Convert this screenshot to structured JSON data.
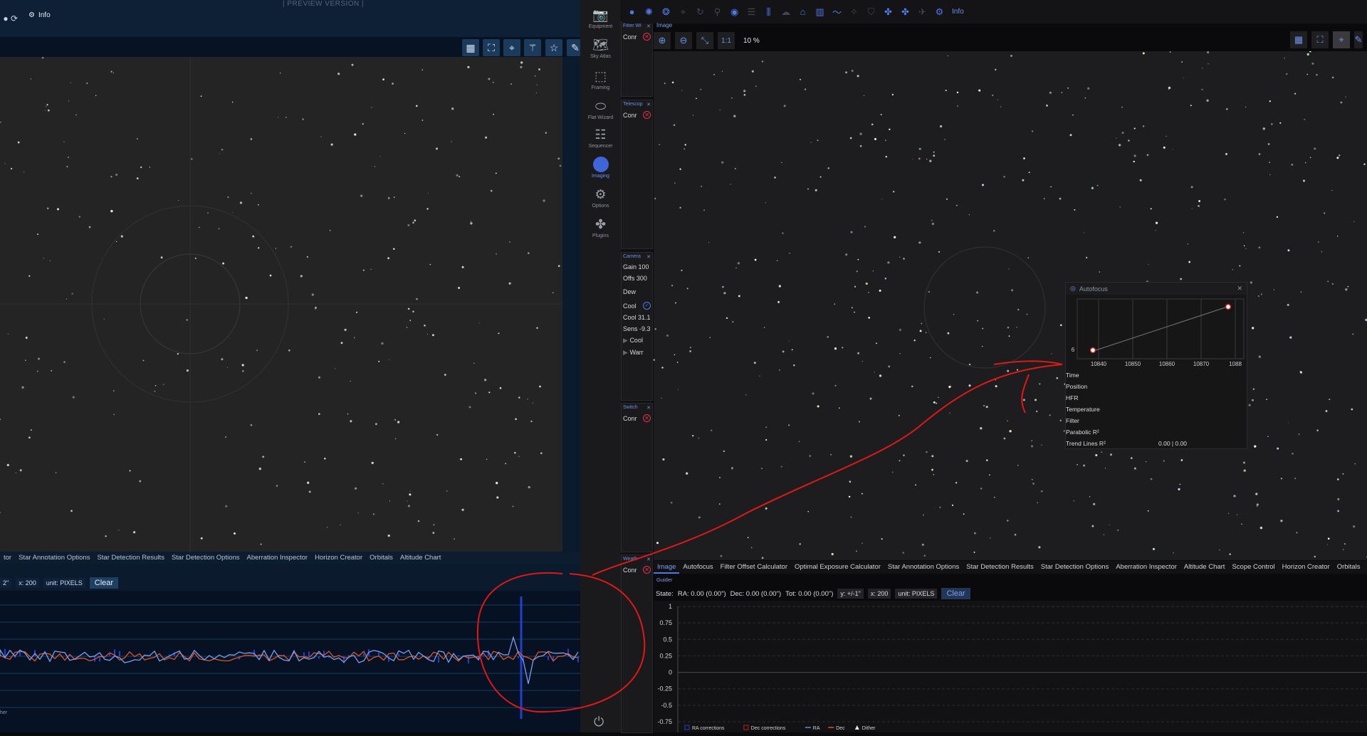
{
  "left_window": {
    "preview_label": "| PREVIEW VERSION |",
    "info_label": "Info",
    "tabs": [
      "tor",
      "Star Annotation Options",
      "Star Detection Results",
      "Star Detection Options",
      "Aberration Inspector",
      "Horizon Creator",
      "Orbitals",
      "Altitude Chart"
    ],
    "graph_controls": {
      "y_select": "2\"",
      "x_select": "x: 200",
      "unit_select": "unit: PIXELS",
      "clear": "Clear"
    },
    "legend_fragment": "her"
  },
  "nav": {
    "items": [
      {
        "label": "Equipment",
        "icon": "camera-icon"
      },
      {
        "label": "Sky Atlas",
        "icon": "map-icon"
      },
      {
        "label": "Framing",
        "icon": "framing-icon"
      },
      {
        "label": "Flat Wizard",
        "icon": "flat-wizard-icon"
      },
      {
        "label": "Sequencer",
        "icon": "sequencer-icon"
      },
      {
        "label": "Imaging",
        "icon": "imaging-icon"
      },
      {
        "label": "Options",
        "icon": "gears-icon"
      },
      {
        "label": "Plugins",
        "icon": "puzzle-icon"
      }
    ]
  },
  "equipment_panels": {
    "filter_wheel": {
      "title": "Filter Wl",
      "row": "Conr"
    },
    "telescope": {
      "title": "Telescop",
      "row": "Conr"
    },
    "camera": {
      "title": "Camera",
      "gain": "Gain",
      "gain_val": "100",
      "offset": "Offs",
      "offset_val": "300",
      "dew": "Dew",
      "cooler": "Cool",
      "cool_temp": "Cool",
      "cool_temp_val": "31.1",
      "sensor": "Sens",
      "sensor_val": "-9.3",
      "cool_toggle": "Cool",
      "warm_toggle": "Warr"
    },
    "switch": {
      "title": "Switch",
      "row": "Conr"
    },
    "weather": {
      "title": "Weath",
      "row": "Conr"
    }
  },
  "image_panel": {
    "title": "Image",
    "zoom_one": "1:1",
    "zoom_level": "10 %",
    "info_label": "Info"
  },
  "autofocus": {
    "title": "Autofocus",
    "y_tick": "6",
    "x_ticks": [
      "10840",
      "10850",
      "10860",
      "10870",
      "1088"
    ],
    "rows": [
      {
        "key": "Time",
        "value": ""
      },
      {
        "key": "Position",
        "value": ""
      },
      {
        "key": "HFR",
        "value": ""
      },
      {
        "key": "Temperature",
        "value": ""
      },
      {
        "key": "Filter",
        "value": ""
      },
      {
        "key": "Parabolic R²",
        "value": ""
      },
      {
        "key": "Trend Lines R²",
        "value": "0.00 | 0.00"
      }
    ]
  },
  "bottom_tabs": [
    "Image",
    "Autofocus",
    "Filter Offset Calculator",
    "Optimal Exposure Calculator",
    "Star Annotation Options",
    "Star Detection Results",
    "Star Detection Options",
    "Aberration Inspector",
    "Altitude Chart",
    "Scope Control",
    "Horizon Creator",
    "Orbitals"
  ],
  "guider": {
    "title": "Guider",
    "state": "State:",
    "ra": "RA: 0.00 (0.00\")",
    "dec": "Dec: 0.00 (0.00\")",
    "tot": "Tot: 0.00 (0.00\")",
    "y_select": "y: +/-1\"",
    "x_select": "x: 200",
    "unit_select": "unit: PIXELS",
    "clear": "Clear",
    "legend": [
      "RA corrections",
      "Dec corrections",
      "RA",
      "Dec",
      "Dither"
    ]
  },
  "chart_data": {
    "type": "line",
    "title": "",
    "y_ticks": [
      "1",
      "0.75",
      "0.5",
      "0.25",
      "0",
      "-0.25",
      "-0.5",
      "-0.75"
    ],
    "ylim": [
      -0.75,
      1
    ],
    "series": [
      {
        "name": "RA",
        "values": []
      },
      {
        "name": "Dec",
        "values": []
      }
    ],
    "colors": {
      "RA": "#5b8ce6",
      "Dec": "#e0552a",
      "RA corrections": "#2340c8",
      "Dec corrections": "#c02020"
    }
  },
  "colors": {
    "accent": "#4f78e6",
    "annotation": "#e01818",
    "error": "#e0334a"
  }
}
